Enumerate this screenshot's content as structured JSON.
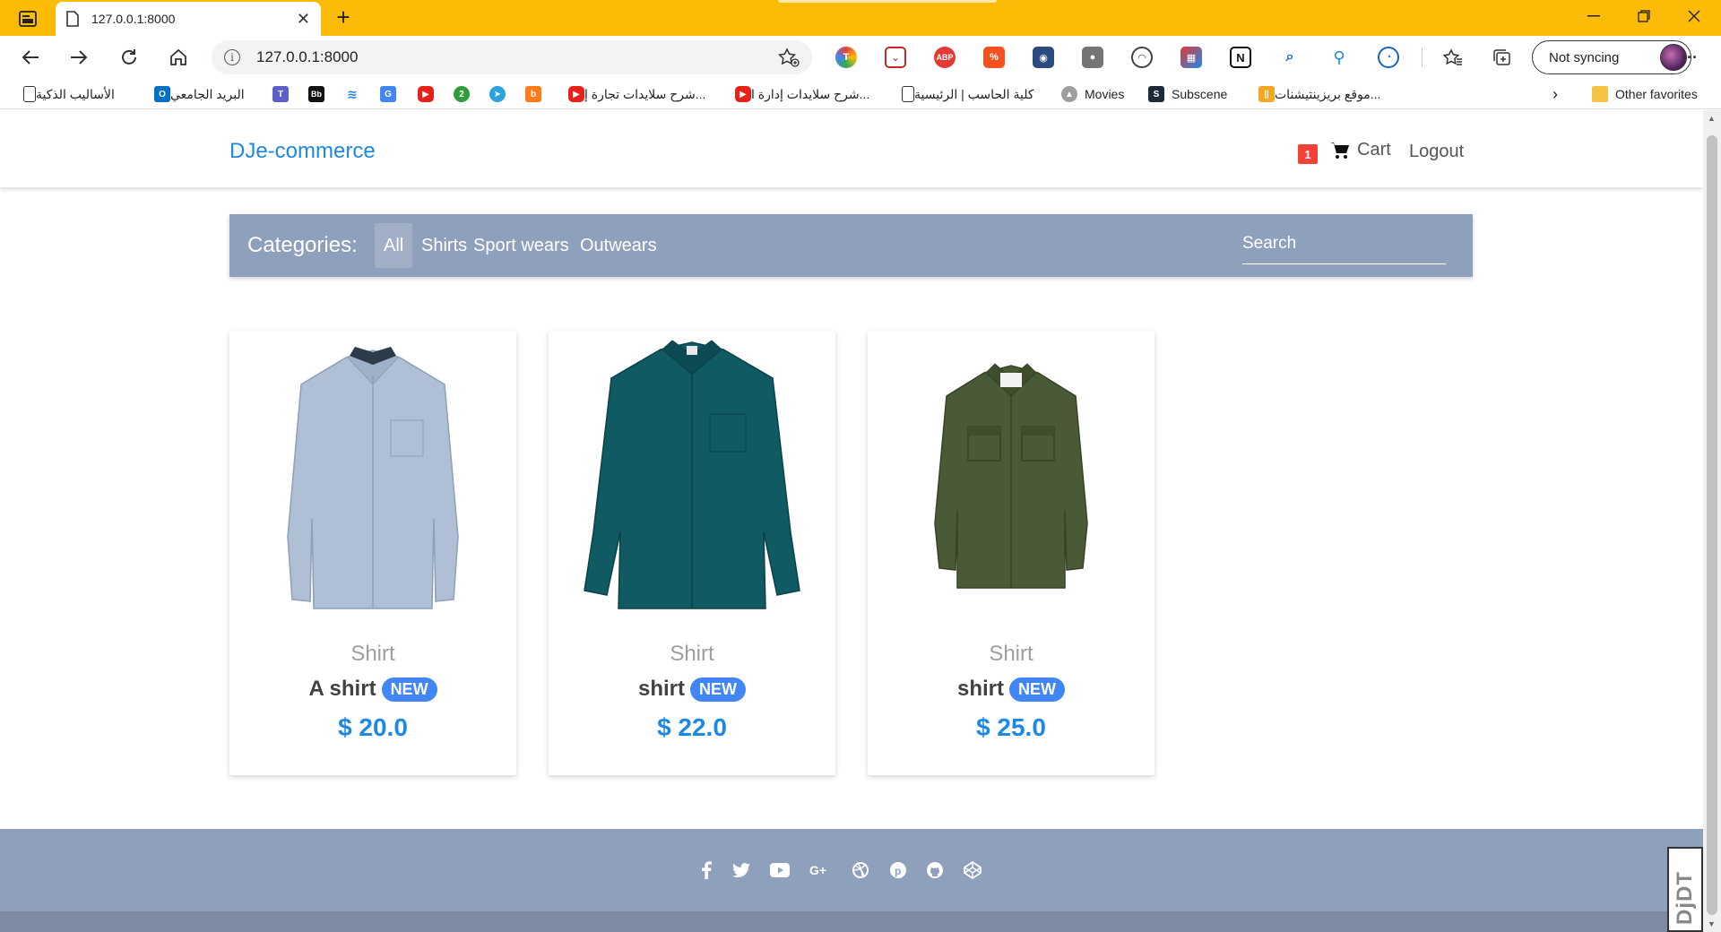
{
  "browser": {
    "tab_title": "127.0.0.1:8000",
    "new_tab_symbol": "+",
    "url": "127.0.0.1:8000",
    "profile_label": "Not syncing",
    "more_label": "···",
    "accent_color": "#fbbb06"
  },
  "bookmarks": {
    "items": [
      {
        "label": "الأساليب الذكية",
        "icon": "page-icon"
      },
      {
        "label": "البريد الجامعي",
        "icon": "outlook-icon"
      },
      {
        "label": "شرح سلايدات تجارة إ...",
        "icon": "youtube-icon"
      },
      {
        "label": "شرح سلايدات إدارة ا...",
        "icon": "youtube-icon"
      },
      {
        "label": "كلية الحاسب | الرئيسية",
        "icon": "page-icon"
      },
      {
        "label": "Movies",
        "icon": "movies-icon"
      },
      {
        "label": "Subscene",
        "icon": "subscene-icon"
      },
      {
        "label": "موقع بريزينتيشنات...",
        "icon": "slides-icon"
      }
    ],
    "other_favorites": "Other favorites"
  },
  "site": {
    "brand": "DJe-commerce",
    "cart_count": "1",
    "cart_label": "Cart",
    "logout_label": "Logout",
    "categories_label": "Categories:",
    "categories": [
      "All",
      "Shirts",
      "Sport wears",
      "Outwears"
    ],
    "active_category": "All",
    "search_placeholder": "Search",
    "primary_color": "#1e88e5",
    "bar_color": "#8fa0bd"
  },
  "products": [
    {
      "category": "Shirt",
      "name": "A shirt",
      "badge": "NEW",
      "price": "$ 20.0",
      "color": "#aebfd6"
    },
    {
      "category": "Shirt",
      "name": "shirt",
      "badge": "NEW",
      "price": "$ 22.0",
      "color": "#0f5a63"
    },
    {
      "category": "Shirt",
      "name": "shirt",
      "badge": "NEW",
      "price": "$ 25.0",
      "color": "#4b5a36"
    }
  ],
  "footer": {
    "social_icons": [
      "facebook-icon",
      "twitter-icon",
      "youtube-icon",
      "google-plus-icon",
      "dribbble-icon",
      "pinterest-icon",
      "github-icon",
      "codepen-icon"
    ]
  },
  "widget": {
    "label": "DjDT"
  }
}
